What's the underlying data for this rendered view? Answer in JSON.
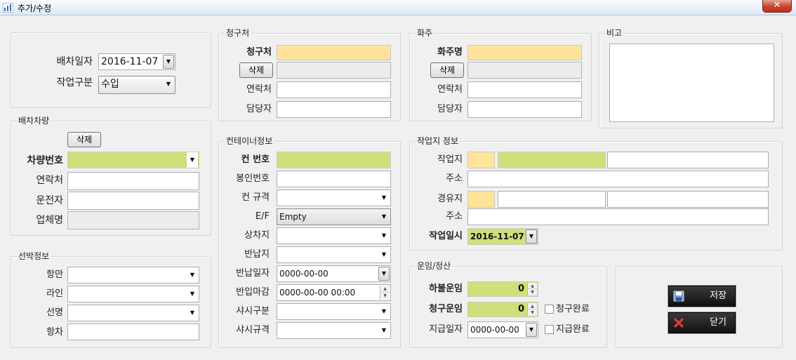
{
  "window": {
    "title": "추가/수정",
    "close_label": "✕"
  },
  "dispatch": {
    "date_label": "배차일자",
    "date_value": "2016-11-07",
    "work_type_label": "작업구분",
    "work_type_value": "수입"
  },
  "vehicle": {
    "group_title": "배차차량",
    "delete_label": "삭제",
    "plate_label": "차량번호",
    "plate_value": "",
    "contact_label": "연락처",
    "contact_value": "",
    "driver_label": "운전자",
    "driver_value": "",
    "company_label": "업체명",
    "company_value": ""
  },
  "vessel": {
    "group_title": "선박정보",
    "port_label": "항만",
    "port_value": "",
    "line_label": "라인",
    "line_value": "",
    "ship_label": "선명",
    "ship_value": "",
    "voyage_label": "항차",
    "voyage_value": ""
  },
  "billing": {
    "group_title": "청구처",
    "name_label": "청구처",
    "name_value": "",
    "delete_label": "삭제",
    "sub_value": "",
    "contact_label": "연락처",
    "contact_value": "",
    "person_label": "담당자",
    "person_value": ""
  },
  "shipper": {
    "group_title": "화주",
    "name_label": "화주명",
    "name_value": "",
    "delete_label": "삭제",
    "sub_value": "",
    "contact_label": "연락처",
    "contact_value": "",
    "person_label": "담당자",
    "person_value": ""
  },
  "remarks": {
    "group_title": "비고",
    "value": ""
  },
  "container": {
    "group_title": "컨테이너정보",
    "number_label": "컨 번호",
    "number_value": "",
    "seal_label": "봉인번호",
    "seal_value": "",
    "spec_label": "컨 규격",
    "spec_value": "",
    "ef_label": "E/F",
    "ef_value": "Empty",
    "pickup_label": "상차지",
    "pickup_value": "",
    "return_label": "반납지",
    "return_value": "",
    "return_date_label": "반납일자",
    "return_date_value": "0000-00-00",
    "cutoff_label": "반입마감",
    "cutoff_value": "0000-00-00 00:00",
    "chassis_type_label": "샤시구분",
    "chassis_type_value": "",
    "chassis_spec_label": "샤시규격",
    "chassis_spec_value": ""
  },
  "worksite": {
    "group_title": "작업지 정보",
    "site_label": "작업지",
    "address_label": "주소",
    "via_label": "경유지",
    "address2_label": "주소",
    "work_date_label": "작업일시",
    "work_date_value": "2016-11-07"
  },
  "freight": {
    "group_title": "운임/정산",
    "cargo_label": "하불운임",
    "cargo_value": "0",
    "billing_label": "청구운임",
    "billing_value": "0",
    "billing_done_label": "청구완료",
    "pay_date_label": "지급일자",
    "pay_date_value": "0000-00-00",
    "pay_done_label": "지급완료"
  },
  "actions": {
    "save_label": "저장",
    "close_label": "닫기"
  },
  "colors": {
    "required_yellow": "#ffe39b",
    "required_green": "#cde07a"
  }
}
